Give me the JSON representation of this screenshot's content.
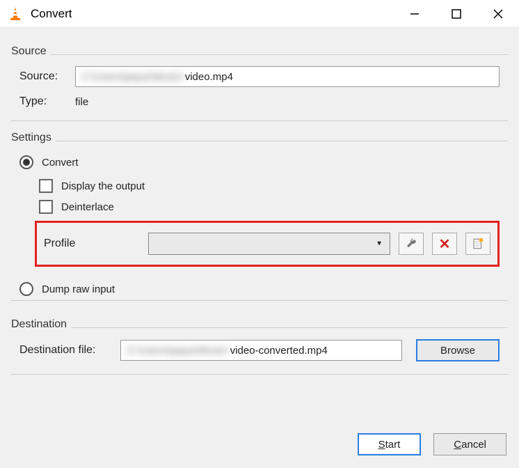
{
  "window": {
    "title": "Convert"
  },
  "source": {
    "group_label": "Source",
    "source_label": "Source:",
    "source_path_blurred": "C:\\Users\\jaque\\Music\\",
    "source_path_visible": "video.mp4",
    "type_label": "Type:",
    "type_value": "file"
  },
  "settings": {
    "group_label": "Settings",
    "convert_label": "Convert",
    "display_output_label": "Display the output",
    "deinterlace_label": "Deinterlace",
    "profile_label": "Profile",
    "profile_selected": "",
    "dump_label": "Dump raw input"
  },
  "destination": {
    "group_label": "Destination",
    "dest_label": "Destination file:",
    "dest_path_blurred": "C:\\Users\\jaque\\Music\\",
    "dest_path_visible": "video-converted.mp4",
    "browse_label": "Browse"
  },
  "footer": {
    "start_label": "Start",
    "cancel_label": "Cancel"
  }
}
